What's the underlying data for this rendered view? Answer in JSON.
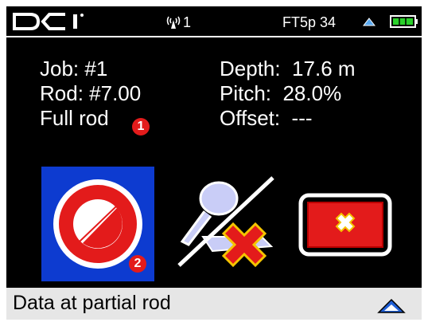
{
  "status_bar": {
    "channel": "1",
    "frequency": "FT5p 34"
  },
  "info": {
    "job": "Job: #1",
    "rod": "Rod: #7.00",
    "rod_state": "Full rod",
    "depth": "Depth:  17.6 m",
    "pitch": "Pitch:  28.0%",
    "offset": "Offset:  ---"
  },
  "badges": {
    "one": "1",
    "two": "2"
  },
  "bottom_bar": {
    "text": "Data at partial rod"
  },
  "colors": {
    "background": "#000000",
    "selected_button": "#0d3bd0",
    "red": "#e31b1b",
    "battery_green": "#2ad12a",
    "bottom_bar": "#e6e6e6"
  },
  "icons": [
    "dci-logo",
    "signal-icon",
    "triangle-up-icon",
    "battery-icon",
    "rod-icon",
    "no-locate-icon",
    "cancel-icon",
    "up-arrow-icon"
  ]
}
